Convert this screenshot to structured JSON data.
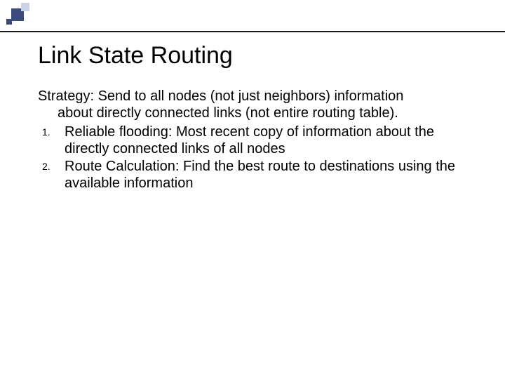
{
  "slide": {
    "title": "Link State Routing",
    "strategy_line1": "Strategy: Send to all nodes (not just neighbors) information",
    "strategy_line2": "about directly connected links (not entire routing table).",
    "items": [
      {
        "num": "1.",
        "text": "Reliable flooding: Most recent copy of information about the directly connected links of all nodes"
      },
      {
        "num": "2.",
        "text": "Route Calculation: Find the best route to destinations using the available information"
      }
    ]
  }
}
